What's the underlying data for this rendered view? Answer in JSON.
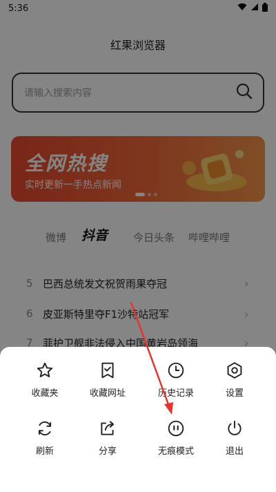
{
  "status_bar": {
    "time": "5:36"
  },
  "app": {
    "title": "红果浏览器"
  },
  "search": {
    "placeholder": "请输入搜索内容"
  },
  "banner": {
    "title": "全网热搜",
    "subtitle": "实时更新一手热点新闻"
  },
  "tabs": [
    {
      "label": "微博"
    },
    {
      "label": "抖音",
      "active": true
    },
    {
      "label": "今日头条"
    },
    {
      "label": "哔哩哔哩"
    }
  ],
  "hot_list": [
    {
      "rank": "5",
      "title": "巴西总统发文祝贺雨果夺冠"
    },
    {
      "rank": "6",
      "title": "皮亚斯特里夺F1沙特站冠军"
    },
    {
      "rank": "7",
      "title": "菲护卫舰非法侵入中国黄岩岛领海"
    }
  ],
  "menu": {
    "items": [
      {
        "label": "收藏夹",
        "icon": "star-icon"
      },
      {
        "label": "收藏网址",
        "icon": "bookmark-check-icon"
      },
      {
        "label": "历史记录",
        "icon": "clock-icon"
      },
      {
        "label": "设置",
        "icon": "settings-hexagon-icon"
      },
      {
        "label": "刷新",
        "icon": "refresh-icon"
      },
      {
        "label": "分享",
        "icon": "share-icon"
      },
      {
        "label": "无痕模式",
        "icon": "incognito-face-icon"
      },
      {
        "label": "退出",
        "icon": "power-icon"
      }
    ]
  },
  "colors": {
    "banner": "#e84a2e",
    "annotation_arrow": "#e8332a",
    "overlay": "rgba(0,0,0,0.48)"
  }
}
